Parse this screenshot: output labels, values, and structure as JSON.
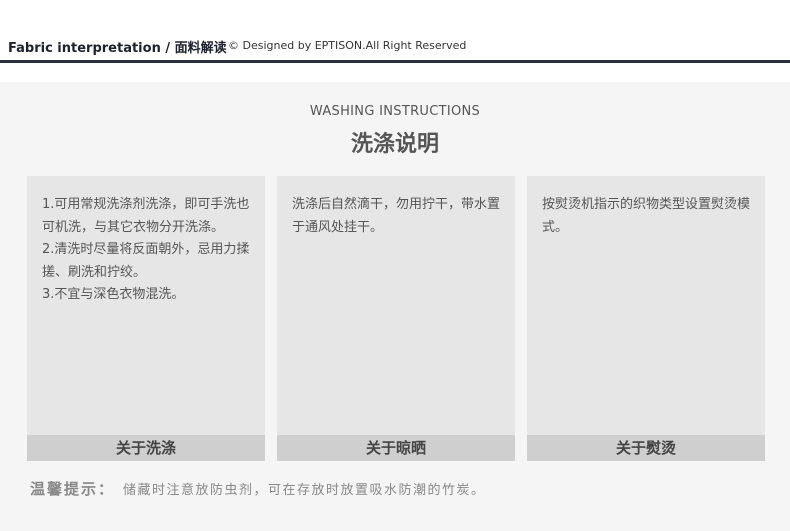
{
  "header": {
    "title": "Fabric interpretation /  面料解读",
    "credit": "© Designed by EPTISON.All Right Reserved"
  },
  "section": {
    "subtitle": "WASHING INSTRUCTIONS",
    "title": "洗涤说明"
  },
  "cards": [
    {
      "lines": [
        "1.可用常规洗涤剂洗涤，即可手洗也可机洗，与其它衣物分开洗涤。",
        "2.清洗时尽量将反面朝外，忌用力揉搓、刷洗和拧绞。",
        "3.不宜与深色衣物混洗。"
      ],
      "footer": "关于洗涤"
    },
    {
      "lines": [
        "洗涤后自然滴干，勿用拧干，带水置于通风处挂干。"
      ],
      "footer": "关于晾晒"
    },
    {
      "lines": [
        "按熨烫机指示的织物类型设置熨烫模式。"
      ],
      "footer": "关于熨烫"
    }
  ],
  "tip": {
    "label": "温馨提示：",
    "text": "储藏时注意放防虫剂，可在存放时放置吸水防潮的竹炭。"
  },
  "colors": {
    "header_rule": "#2b2f3e",
    "panel_background": "#f5f5f5",
    "card_background": "#e6e6e6",
    "card_footer": "#cfcfcf"
  }
}
